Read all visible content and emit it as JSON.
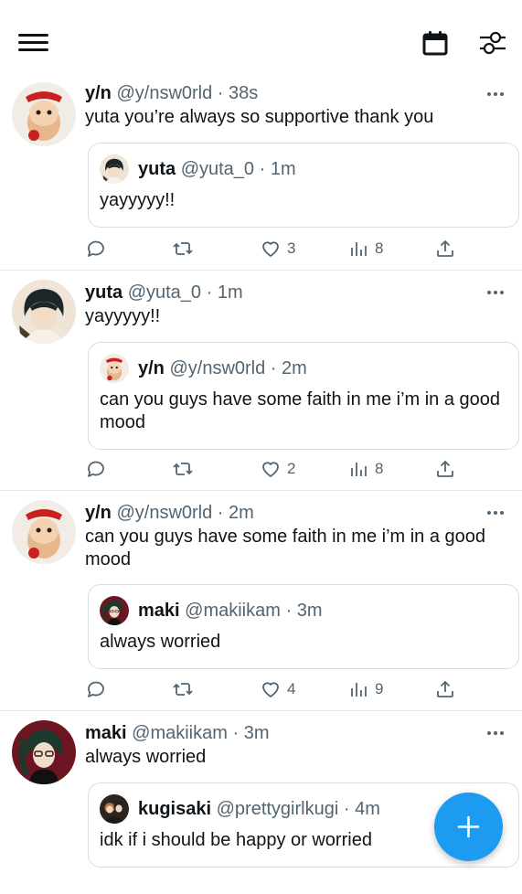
{
  "colors": {
    "accent": "#1d9bf0",
    "text": "#0f1419",
    "muted": "#536471",
    "divider": "#e6e9ec"
  },
  "topbar": {
    "icons": [
      "menu-icon",
      "calendar-icon",
      "filter-icon"
    ]
  },
  "tweets": [
    {
      "name": "y/n",
      "handle": "@y/nsw0rld",
      "time": "38s",
      "text": "yuta you’re always so supportive thank you",
      "quote": {
        "name": "yuta",
        "handle": "@yuta_0",
        "time": "1m",
        "text": "yayyyyy!!"
      },
      "likes": "3",
      "views": "8"
    },
    {
      "name": "yuta",
      "handle": "@yuta_0",
      "time": "1m",
      "text": "yayyyyy!!",
      "quote": {
        "name": "y/n",
        "handle": "@y/nsw0rld",
        "time": "2m",
        "text": "can you guys have some faith in me i’m in a good mood"
      },
      "likes": "2",
      "views": "8"
    },
    {
      "name": "y/n",
      "handle": "@y/nsw0rld",
      "time": "2m",
      "text": "can you guys have some faith in me i’m in a good mood",
      "quote": {
        "name": "maki",
        "handle": "@makiikam",
        "time": "3m",
        "text": "always worried"
      },
      "likes": "4",
      "views": "9"
    },
    {
      "name": "maki",
      "handle": "@makiikam",
      "time": "3m",
      "text": "always worried",
      "quote": {
        "name": "kugisaki",
        "handle": "@prettygirlkugi",
        "time": "4m",
        "text": "idk if i should be happy or worried"
      }
    }
  ],
  "separator": " · "
}
